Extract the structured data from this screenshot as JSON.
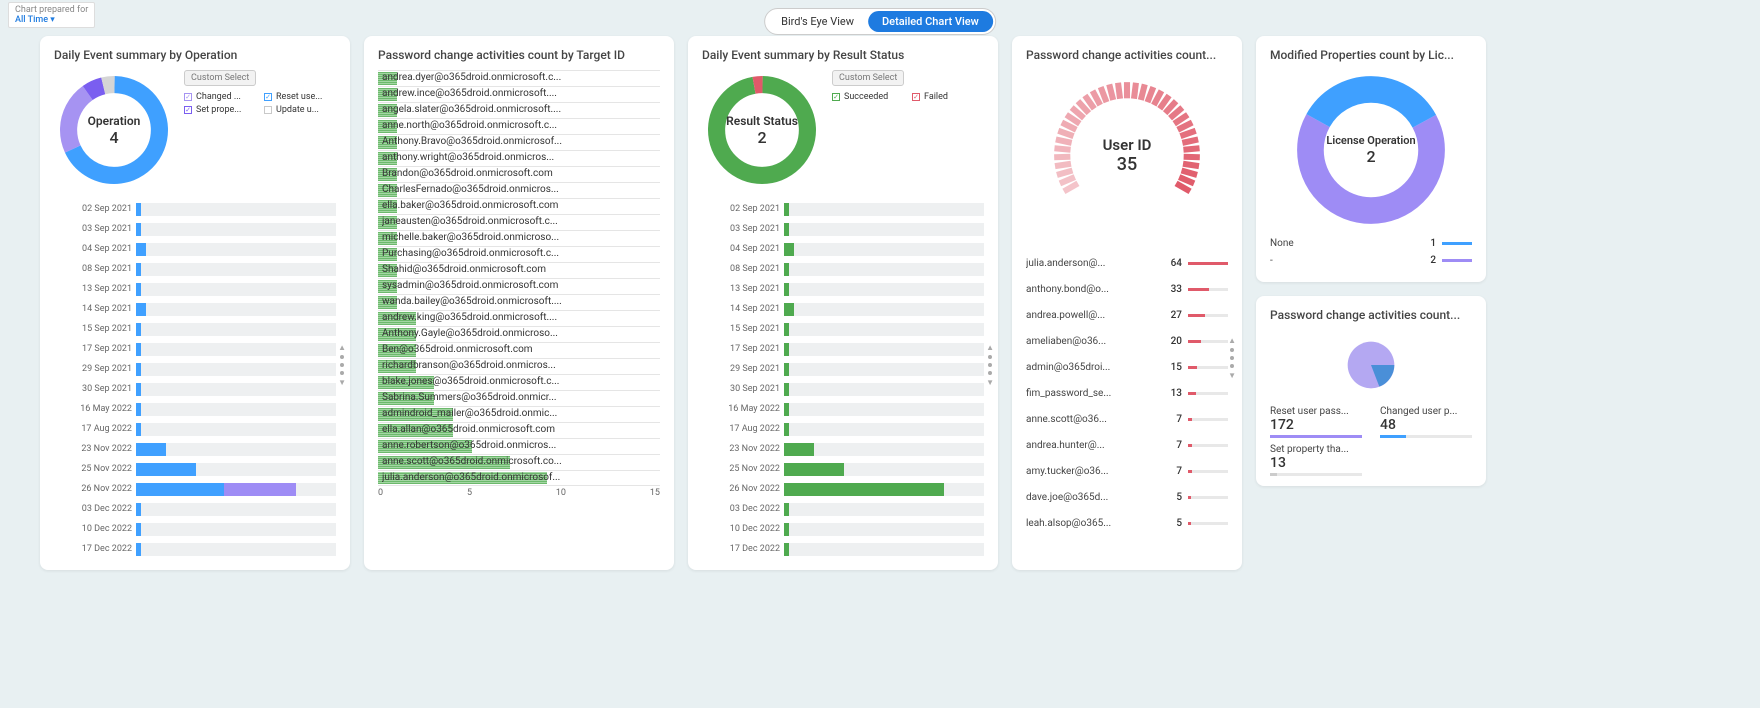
{
  "header": {
    "prep_label": "Chart prepared for",
    "prep_value": "All Time",
    "view_birds": "Bird's Eye View",
    "view_detailed": "Detailed Chart View"
  },
  "card1": {
    "title": "Daily Event summary by Operation",
    "donut_label": "Operation",
    "donut_value": "4",
    "legend_btn": "Custom Select",
    "legend": [
      {
        "label": "Changed ...",
        "color": "#a693f2",
        "checked": true
      },
      {
        "label": "Reset use...",
        "color": "#3fa0ff",
        "checked": true
      },
      {
        "label": "Set prope...",
        "color": "#7a5ef0",
        "checked": true
      },
      {
        "label": "Update u...",
        "color": "#c9c9c9",
        "checked": false
      }
    ],
    "rows": [
      {
        "label": "02 Sep 2021",
        "v": 1
      },
      {
        "label": "03 Sep 2021",
        "v": 1
      },
      {
        "label": "04 Sep 2021",
        "v": 2
      },
      {
        "label": "08 Sep 2021",
        "v": 1
      },
      {
        "label": "13 Sep 2021",
        "v": 1
      },
      {
        "label": "14 Sep 2021",
        "v": 2
      },
      {
        "label": "15 Sep 2021",
        "v": 1
      },
      {
        "label": "17 Sep 2021",
        "v": 1
      },
      {
        "label": "29 Sep 2021",
        "v": 1
      },
      {
        "label": "30 Sep 2021",
        "v": 1
      },
      {
        "label": "16 May 2022",
        "v": 1
      },
      {
        "label": "17 Aug 2022",
        "v": 1
      },
      {
        "label": "23 Nov 2022",
        "v": 6
      },
      {
        "label": "25 Nov 2022",
        "v": 12
      },
      {
        "label": "26 Nov 2022",
        "v": 32,
        "split": true
      },
      {
        "label": "03 Dec 2022",
        "v": 1
      },
      {
        "label": "10 Dec 2022",
        "v": 1
      },
      {
        "label": "17 Dec 2022",
        "v": 1
      }
    ],
    "max": 40
  },
  "card2": {
    "title": "Password change activities count by Target ID",
    "rows": [
      {
        "label": "andrea.dyer@o365droid.onmicrosoft.c...",
        "v": 1
      },
      {
        "label": "andrew.ince@o365droid.onmicrosoft....",
        "v": 1
      },
      {
        "label": "angela.slater@o365droid.onmicrosoft....",
        "v": 1
      },
      {
        "label": "anne.north@o365droid.onmicrosoft.c...",
        "v": 1
      },
      {
        "label": "Anthony.Bravo@o365droid.onmicrosof...",
        "v": 1
      },
      {
        "label": "anthony.wright@o365droid.onmicros...",
        "v": 1
      },
      {
        "label": "Brandon@o365droid.onmicrosoft.com",
        "v": 1
      },
      {
        "label": "CharlesFernado@o365droid.onmicros...",
        "v": 1
      },
      {
        "label": "ella.baker@o365droid.onmicrosoft.com",
        "v": 1
      },
      {
        "label": "janeausten@o365droid.onmicrosoft.c...",
        "v": 1
      },
      {
        "label": "michelle.baker@o365droid.onmicroso...",
        "v": 1
      },
      {
        "label": "Purchasing@o365droid.onmicrosoft.c...",
        "v": 1
      },
      {
        "label": "Shahid@o365droid.onmicrosoft.com",
        "v": 1
      },
      {
        "label": "sysadmin@o365droid.onmicrosoft.com",
        "v": 1
      },
      {
        "label": "wanda.bailey@o365droid.onmicrosoft....",
        "v": 1
      },
      {
        "label": "andrew.king@o365droid.onmicrosoft....",
        "v": 2
      },
      {
        "label": "Anthony.Gayle@o365droid.onmicroso...",
        "v": 2
      },
      {
        "label": "Ben@o365droid.onmicrosoft.com",
        "v": 2
      },
      {
        "label": "richardbranson@o365droid.onmicros...",
        "v": 2
      },
      {
        "label": "blake.jones@o365droid.onmicrosoft.c...",
        "v": 3
      },
      {
        "label": "Sabrina.Summers@o365droid.onmicr...",
        "v": 3
      },
      {
        "label": "admindroid_mailer@o365droid.onmic...",
        "v": 4
      },
      {
        "label": "ella.allan@o365droid.onmicrosoft.com",
        "v": 4
      },
      {
        "label": "anne.robertson@o365droid.onmicros...",
        "v": 5
      },
      {
        "label": "anne.scott@o365droid.onmicrosoft.co...",
        "v": 7
      },
      {
        "label": "julia.anderson@o365droid.onmicrosof...",
        "v": 9
      }
    ],
    "axis": [
      "0",
      "5",
      "10",
      "15"
    ],
    "max": 15
  },
  "card3": {
    "title": "Daily Event summary by Result Status",
    "donut_label": "Result Status",
    "donut_value": "2",
    "legend_btn": "Custom Select",
    "legend": [
      {
        "label": "Succeeded",
        "color": "#4faa4f",
        "checked": true
      },
      {
        "label": "Failed",
        "color": "#e05a6a",
        "checked": true
      }
    ],
    "rows": [
      {
        "label": "02 Sep 2021",
        "v": 1
      },
      {
        "label": "03 Sep 2021",
        "v": 1
      },
      {
        "label": "04 Sep 2021",
        "v": 2
      },
      {
        "label": "08 Sep 2021",
        "v": 1
      },
      {
        "label": "13 Sep 2021",
        "v": 1
      },
      {
        "label": "14 Sep 2021",
        "v": 2
      },
      {
        "label": "15 Sep 2021",
        "v": 1
      },
      {
        "label": "17 Sep 2021",
        "v": 1
      },
      {
        "label": "29 Sep 2021",
        "v": 1
      },
      {
        "label": "30 Sep 2021",
        "v": 1
      },
      {
        "label": "16 May 2022",
        "v": 1
      },
      {
        "label": "17 Aug 2022",
        "v": 1
      },
      {
        "label": "23 Nov 2022",
        "v": 6
      },
      {
        "label": "25 Nov 2022",
        "v": 12
      },
      {
        "label": "26 Nov 2022",
        "v": 32
      },
      {
        "label": "03 Dec 2022",
        "v": 1
      },
      {
        "label": "10 Dec 2022",
        "v": 1
      },
      {
        "label": "17 Dec 2022",
        "v": 1
      }
    ],
    "max": 40
  },
  "card4": {
    "title": "Password change activities count...",
    "donut_label": "User ID",
    "donut_value": "35",
    "rows": [
      {
        "label": "julia.anderson@...",
        "v": 64
      },
      {
        "label": "anthony.bond@o...",
        "v": 33
      },
      {
        "label": "andrea.powell@...",
        "v": 27
      },
      {
        "label": "ameliaben@o36...",
        "v": 20
      },
      {
        "label": "admin@o365droi...",
        "v": 15
      },
      {
        "label": "fim_password_se...",
        "v": 13
      },
      {
        "label": "anne.scott@o36...",
        "v": 7
      },
      {
        "label": "andrea.hunter@...",
        "v": 7
      },
      {
        "label": "amy.tucker@o36...",
        "v": 7
      },
      {
        "label": "dave.joe@o365d...",
        "v": 5
      },
      {
        "label": "leah.alsop@o365...",
        "v": 5
      }
    ],
    "max": 64
  },
  "card5a": {
    "title": "Modified Properties count by Lic...",
    "donut_label": "License Operation",
    "donut_value": "2",
    "rows": [
      {
        "label": "None",
        "v": 1,
        "color": "#3fa0ff"
      },
      {
        "label": "-",
        "v": 2,
        "color": "#9e8cf5"
      }
    ]
  },
  "card5b": {
    "title": "Password change activities count...",
    "stats": [
      {
        "label": "Reset user pass...",
        "v": 172,
        "color": "#9e8cf5"
      },
      {
        "label": "Changed user p...",
        "v": 48,
        "color": "#3fa0ff"
      },
      {
        "label": "Set property tha...",
        "v": 13,
        "color": "#ccc"
      }
    ]
  },
  "chart_data": [
    {
      "type": "bar",
      "title": "Daily Event summary by Operation",
      "categories": [
        "02 Sep 2021",
        "03 Sep 2021",
        "04 Sep 2021",
        "08 Sep 2021",
        "13 Sep 2021",
        "14 Sep 2021",
        "15 Sep 2021",
        "17 Sep 2021",
        "29 Sep 2021",
        "30 Sep 2021",
        "16 May 2022",
        "17 Aug 2022",
        "23 Nov 2022",
        "25 Nov 2022",
        "26 Nov 2022",
        "03 Dec 2022",
        "10 Dec 2022",
        "17 Dec 2022"
      ],
      "values": [
        1,
        1,
        2,
        1,
        1,
        2,
        1,
        1,
        1,
        1,
        1,
        1,
        6,
        12,
        32,
        1,
        1,
        1
      ]
    },
    {
      "type": "bar",
      "title": "Password change activities count by Target ID",
      "categories": [
        "andrea.dyer",
        "andrew.ince",
        "angela.slater",
        "anne.north",
        "Anthony.Bravo",
        "anthony.wright",
        "Brandon",
        "CharlesFernado",
        "ella.baker",
        "janeausten",
        "michelle.baker",
        "Purchasing",
        "Shahid",
        "sysadmin",
        "wanda.bailey",
        "andrew.king",
        "Anthony.Gayle",
        "Ben",
        "richardbranson",
        "blake.jones",
        "Sabrina.Summers",
        "admindroid_mailer",
        "ella.allan",
        "anne.robertson",
        "anne.scott",
        "julia.anderson"
      ],
      "values": [
        1,
        1,
        1,
        1,
        1,
        1,
        1,
        1,
        1,
        1,
        1,
        1,
        1,
        1,
        1,
        2,
        2,
        2,
        2,
        3,
        3,
        4,
        4,
        5,
        7,
        9
      ],
      "xlim": [
        0,
        15
      ]
    },
    {
      "type": "bar",
      "title": "Daily Event summary by Result Status",
      "categories": [
        "02 Sep 2021",
        "03 Sep 2021",
        "04 Sep 2021",
        "08 Sep 2021",
        "13 Sep 2021",
        "14 Sep 2021",
        "15 Sep 2021",
        "17 Sep 2021",
        "29 Sep 2021",
        "30 Sep 2021",
        "16 May 2022",
        "17 Aug 2022",
        "23 Nov 2022",
        "25 Nov 2022",
        "26 Nov 2022",
        "03 Dec 2022",
        "10 Dec 2022",
        "17 Dec 2022"
      ],
      "values": [
        1,
        1,
        2,
        1,
        1,
        2,
        1,
        1,
        1,
        1,
        1,
        1,
        6,
        12,
        32,
        1,
        1,
        1
      ]
    },
    {
      "type": "bar",
      "title": "Password change activities count by User ID",
      "categories": [
        "julia.anderson",
        "anthony.bond",
        "andrea.powell",
        "ameliaben",
        "admin",
        "fim_password_service",
        "anne.scott",
        "andrea.hunter",
        "amy.tucker",
        "dave.joe",
        "leah.alsop"
      ],
      "values": [
        64,
        33,
        27,
        20,
        15,
        13,
        7,
        7,
        7,
        5,
        5
      ]
    },
    {
      "type": "pie",
      "title": "Modified Properties count by License Operation",
      "categories": [
        "None",
        "-"
      ],
      "values": [
        1,
        2
      ]
    },
    {
      "type": "pie",
      "title": "Password change activities count",
      "categories": [
        "Reset user password",
        "Changed user password",
        "Set property that forces password change"
      ],
      "values": [
        172,
        48,
        13
      ]
    }
  ]
}
